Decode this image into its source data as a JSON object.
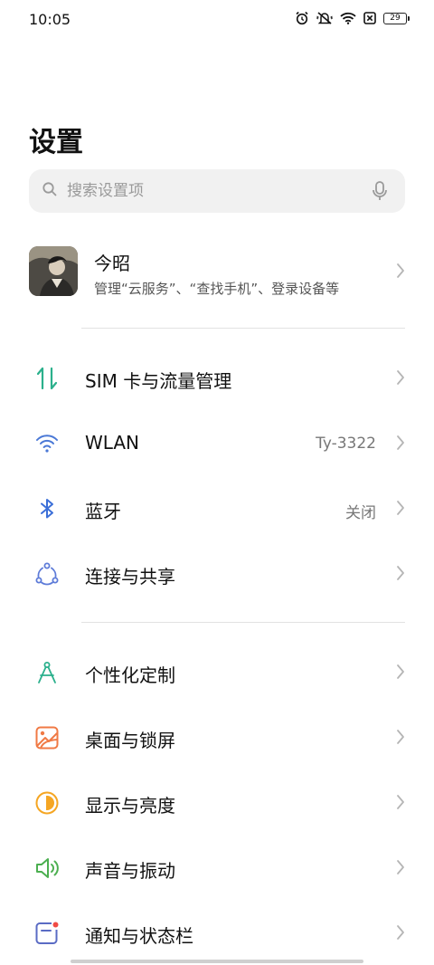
{
  "status_bar": {
    "time": "10:05",
    "battery_level": "29",
    "icons": [
      "alarm-icon",
      "vibrate-icon",
      "wifi-icon",
      "sim-off-icon",
      "battery-icon"
    ]
  },
  "page": {
    "title": "设置"
  },
  "search": {
    "placeholder": "搜索设置项",
    "value": ""
  },
  "account": {
    "name": "今昭",
    "subtitle": "管理“云服务”、“查找手机”、登录设备等"
  },
  "sections": [
    {
      "items": [
        {
          "icon": "sim-data-icon",
          "label": "SIM 卡与流量管理",
          "value": ""
        },
        {
          "icon": "wlan-icon",
          "label": "WLAN",
          "value": "Ty-3322"
        },
        {
          "icon": "bluetooth-icon",
          "label": "蓝牙",
          "value": "关闭"
        },
        {
          "icon": "connection-share-icon",
          "label": "连接与共享",
          "value": ""
        }
      ]
    },
    {
      "items": [
        {
          "icon": "personalize-icon",
          "label": "个性化定制",
          "value": ""
        },
        {
          "icon": "wallpaper-icon",
          "label": "桌面与锁屏",
          "value": ""
        },
        {
          "icon": "display-brightness-icon",
          "label": "显示与亮度",
          "value": ""
        },
        {
          "icon": "sound-icon",
          "label": "声音与振动",
          "value": ""
        },
        {
          "icon": "notification-icon",
          "label": "通知与状态栏",
          "value": ""
        }
      ]
    }
  ],
  "colors": {
    "sim": "#2bb08c",
    "wlan": "#4a78d6",
    "bluetooth": "#3b6fd8",
    "share": "#5d7bd8",
    "personalize": "#2bb08c",
    "wallpaper": "#f07a45",
    "display": "#f5a623",
    "sound": "#4caf50",
    "notification": "#5a6bc4",
    "notification_dot": "#f04b45"
  }
}
